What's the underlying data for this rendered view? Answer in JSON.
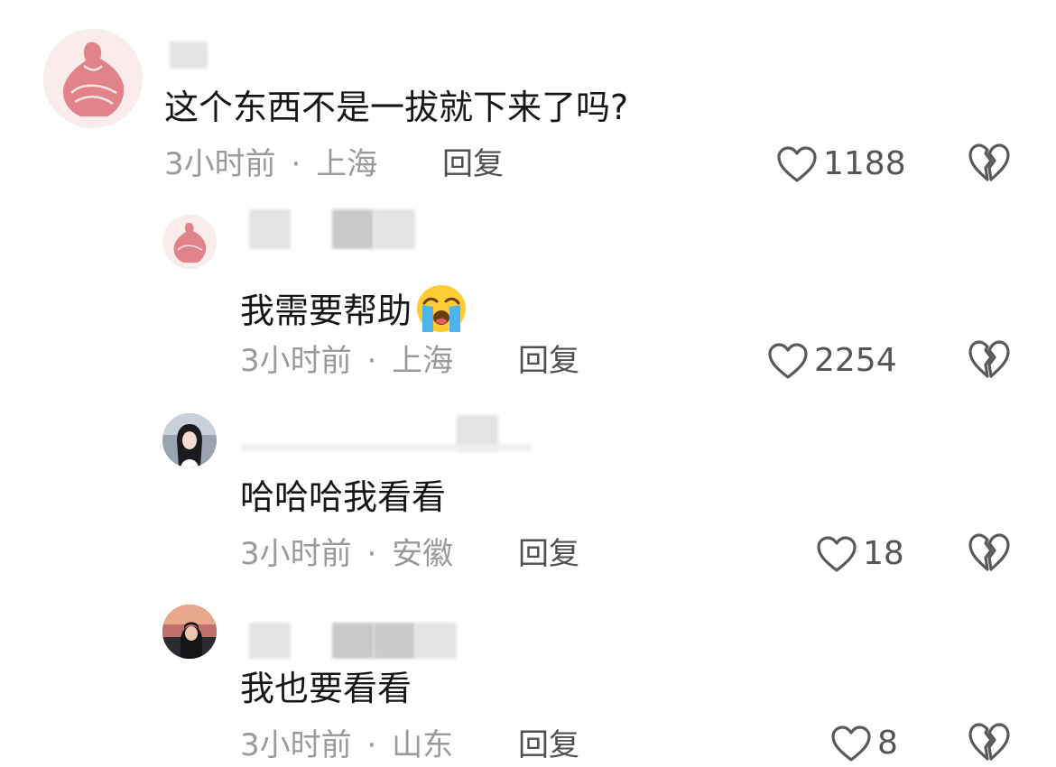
{
  "comments": [
    {
      "text": "这个东西不是一拔就下来了吗?",
      "time": "3小时前",
      "separator": "·",
      "location": "上海",
      "reply_label": "回复",
      "likes": "1188"
    },
    {
      "text": "我需要帮助",
      "emoji": "loudly-crying-face",
      "time": "3小时前",
      "separator": "·",
      "location": "上海",
      "reply_label": "回复",
      "likes": "2254"
    },
    {
      "text": "哈哈哈我看看",
      "time": "3小时前",
      "separator": "·",
      "location": "安徽",
      "reply_label": "回复",
      "likes": "18"
    },
    {
      "text": "我也要看看",
      "time": "3小时前",
      "separator": "·",
      "location": "山东",
      "reply_label": "回复",
      "likes": "8"
    }
  ],
  "icons": {
    "like": "heart-outline-icon",
    "dislike": "broken-heart-icon"
  },
  "colors": {
    "text": "#161616",
    "meta": "#9a9a9a",
    "reply": "#4f4f4f",
    "icon": "#5a5a5a"
  }
}
